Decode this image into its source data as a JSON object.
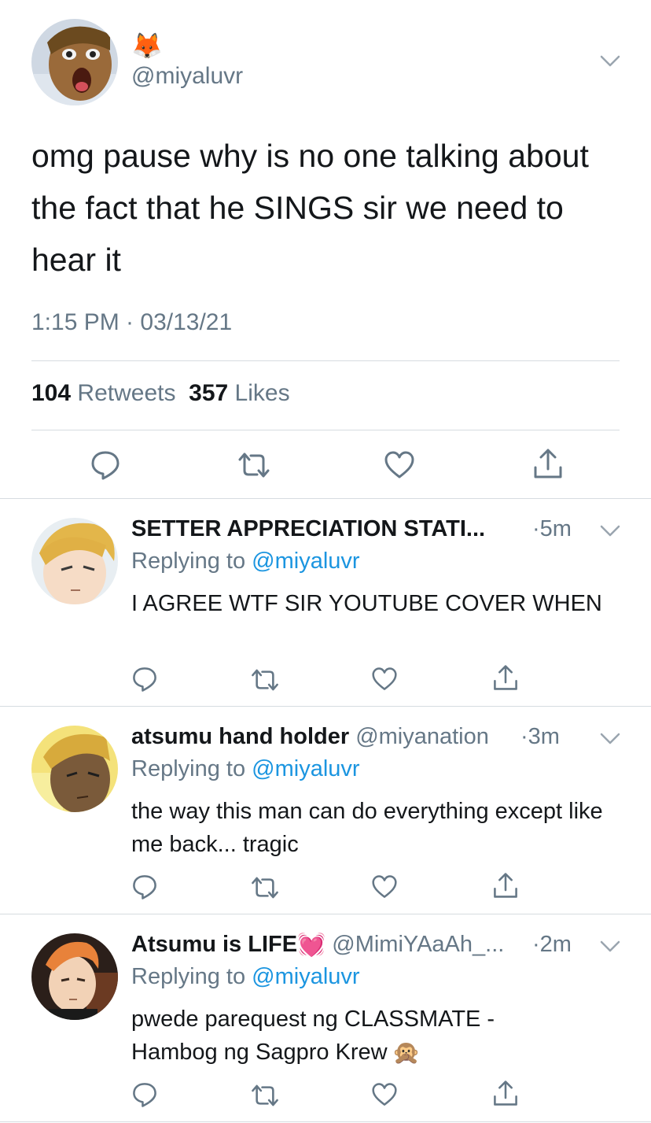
{
  "main_tweet": {
    "emoji": "🦊",
    "handle": "@miyaluvr",
    "text": "omg pause why is no one talking about the fact that he SINGS sir we need to hear it",
    "timestamp": "1:15 PM · 03/13/21",
    "retweets_count": "104",
    "retweets_label": "Retweets",
    "likes_count": "357",
    "likes_label": "Likes"
  },
  "replies": [
    {
      "name": "SETTER APPRECIATION STATI...",
      "handle": "",
      "time": "·5m",
      "replying_label": "Replying to",
      "replying_to": "@miyaluvr",
      "text": "I AGREE WTF SIR YOUTUBE COVER WHEN"
    },
    {
      "name": "atsumu hand holder",
      "handle": "@miyanation",
      "time": "·3m",
      "replying_label": "Replying to",
      "replying_to": "@miyaluvr",
      "text": "the way this man can do everything except like me back... tragic"
    },
    {
      "name": "Atsumu is LIFE",
      "name_emoji": "💓",
      "handle": "@MimiYAaAh_...",
      "time": "·2m",
      "replying_label": "Replying to",
      "replying_to": "@miyaluvr",
      "text": "pwede parequest ng CLASSMATE - Hambog ng Sagpro Krew",
      "text_emoji": "🙊"
    }
  ],
  "icons": [
    "reply-icon",
    "retweet-icon",
    "like-icon",
    "share-icon",
    "chevron-down-icon"
  ],
  "colors": {
    "text": "#14171a",
    "secondary": "#657786",
    "link": "#1b95e0",
    "divider": "#d6dce0"
  }
}
